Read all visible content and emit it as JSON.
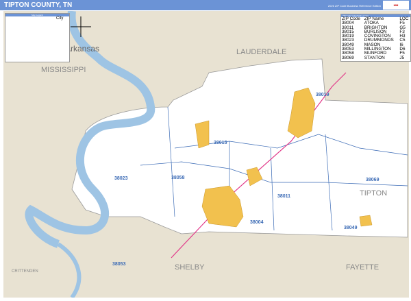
{
  "header": {
    "title": "TIPTON COUNTY, TN",
    "edition": "2026 ZIP Code Business Reference Edition",
    "logo": "Market MAPS"
  },
  "map": {
    "region_labels": [
      "LAUDERDALE",
      "MISSISSIPPI",
      "Arkansas",
      "SHELBY",
      "FAYETTE",
      "TIPTON",
      "CRITTENDEN"
    ],
    "zip_labels": [
      "38019",
      "38015",
      "38023",
      "38058",
      "38011",
      "38004",
      "38069",
      "38049",
      "38053"
    ],
    "colors": {
      "land": "#e8e2d2",
      "county": "#ffffff",
      "water": "#9ec4e4",
      "city": "#f2c14e",
      "zip_boundary": "#3a6ab5",
      "interstate": "#e23a8a"
    }
  },
  "legend": {
    "title": "Map Legend",
    "city_label": "City"
  },
  "zip_index": {
    "title": "ZIP Code Index/Grid Locator",
    "columns": [
      "ZIP Code",
      "ZIP Name",
      "LOC"
    ],
    "rows": [
      [
        "38004",
        "ATOKA",
        "F5"
      ],
      [
        "38011",
        "BRIGHTON",
        "G5"
      ],
      [
        "38015",
        "BURLISON",
        "F3"
      ],
      [
        "38019",
        "COVINGTON",
        "H3"
      ],
      [
        "38023",
        "DRUMMONDS",
        "C5"
      ],
      [
        "38049",
        "MASON",
        "I6"
      ],
      [
        "38053",
        "MILLINGTON",
        "D6"
      ],
      [
        "38058",
        "MUNFORD",
        "F5"
      ],
      [
        "38069",
        "STANTON",
        "J5"
      ]
    ]
  }
}
